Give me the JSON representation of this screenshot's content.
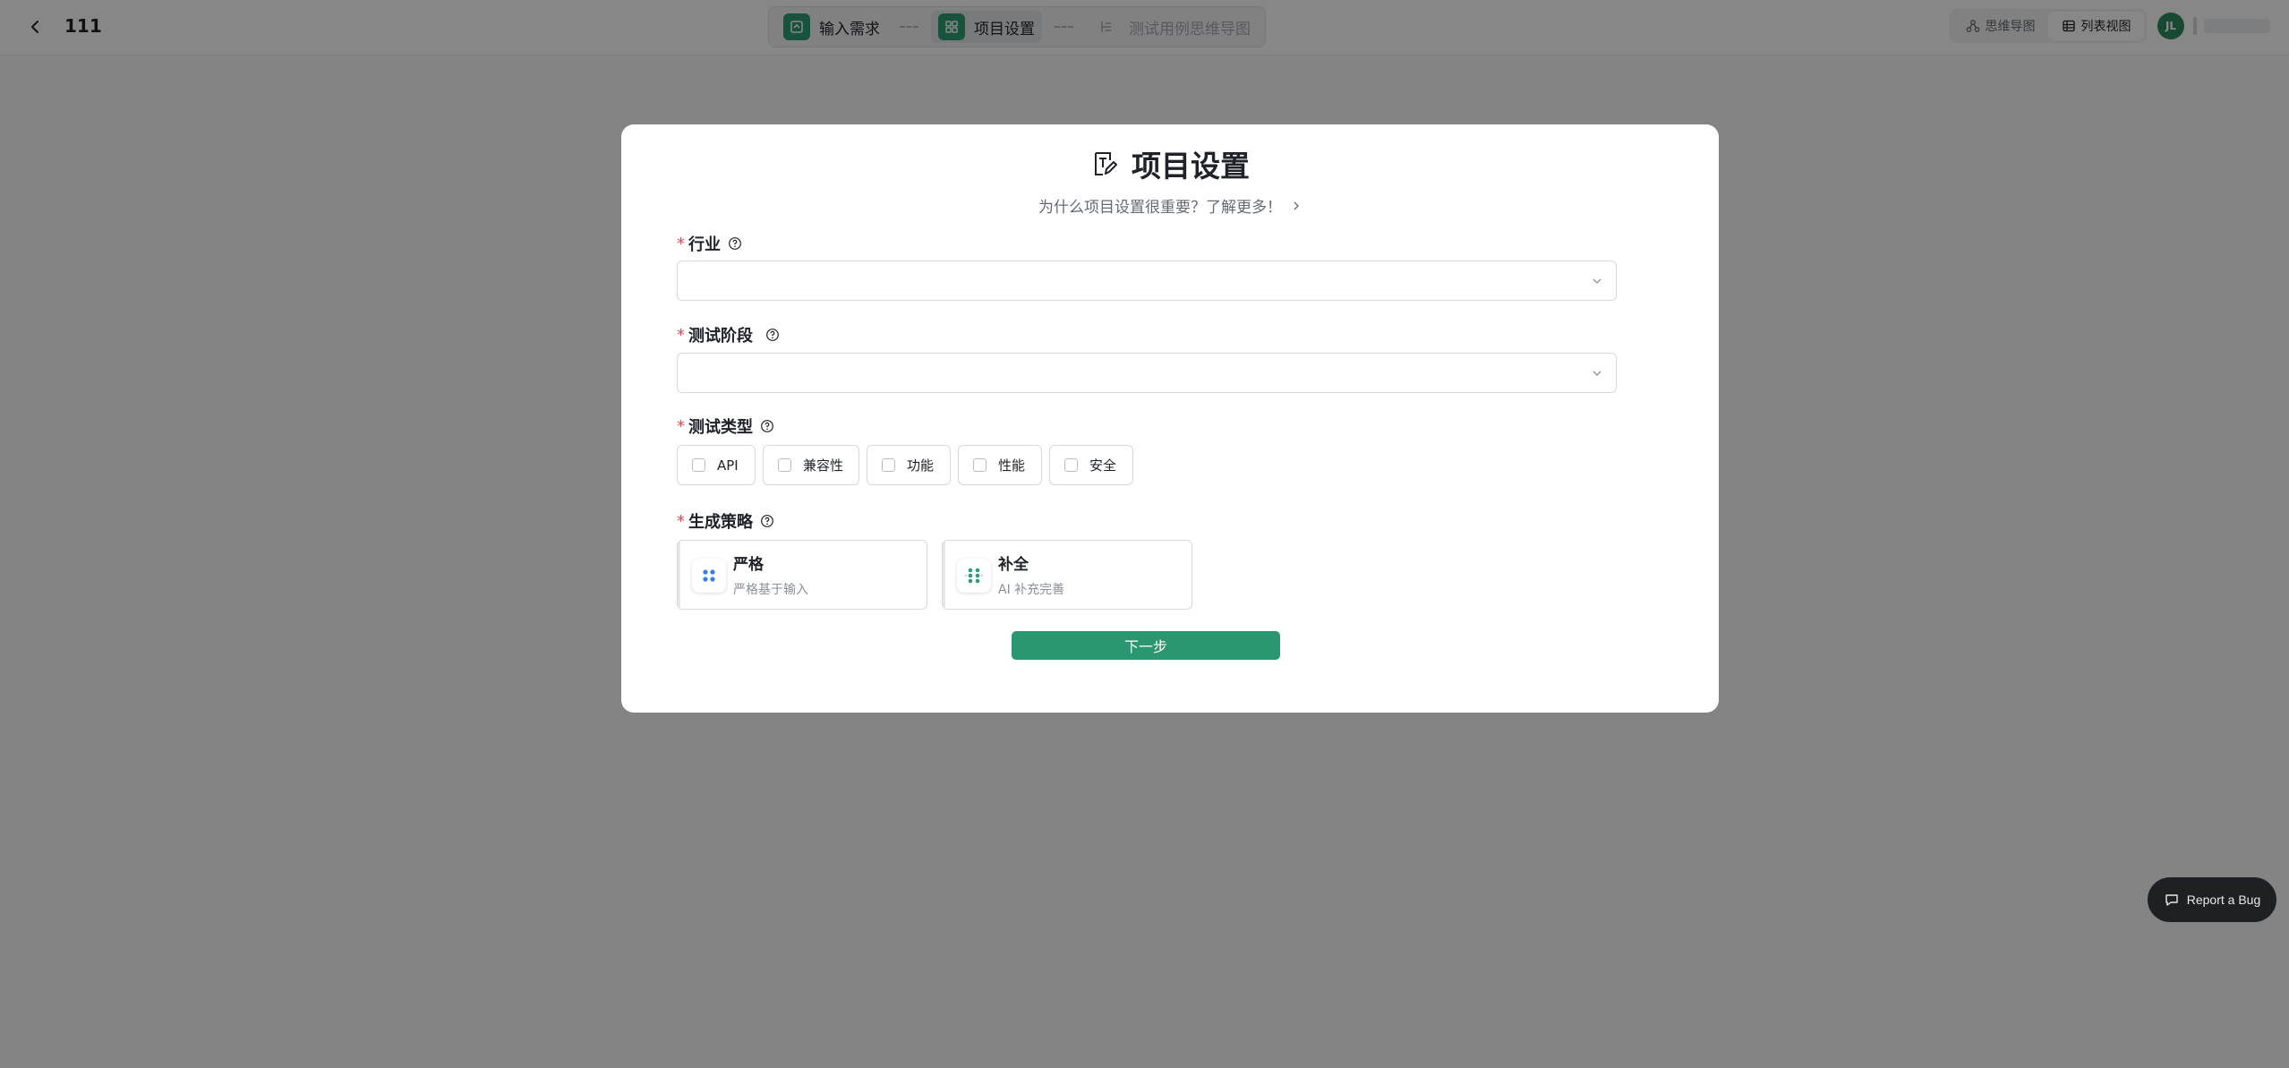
{
  "header": {
    "project_name": "111",
    "steps": [
      {
        "label": "输入需求",
        "state": "done"
      },
      {
        "label": "项目设置",
        "state": "active"
      },
      {
        "label": "测试用例思维导图",
        "state": "disabled"
      }
    ],
    "views": [
      {
        "label": "思维导图",
        "icon": "mindmap-icon",
        "active": false
      },
      {
        "label": "列表视图",
        "icon": "table-icon",
        "active": true
      }
    ],
    "user_initials": "JL"
  },
  "modal": {
    "title": "项目设置",
    "subtitle": "为什么项目设置很重要？了解更多！",
    "fields": {
      "industry": {
        "label": "行业",
        "required_mark": "*",
        "value": ""
      },
      "test_phase": {
        "label": "测试阶段",
        "required_mark": "*",
        "value": ""
      },
      "test_type": {
        "label": "测试类型",
        "required_mark": "*",
        "options": [
          {
            "label": "API",
            "checked": false
          },
          {
            "label": "兼容性",
            "checked": false
          },
          {
            "label": "功能",
            "checked": false
          },
          {
            "label": "性能",
            "checked": false
          },
          {
            "label": "安全",
            "checked": false
          }
        ]
      },
      "strategy": {
        "label": "生成策略",
        "required_mark": "*",
        "options": [
          {
            "title": "严格",
            "desc": "严格基于输入",
            "icon": "grid-dots-icon",
            "color": "#3b7ddd"
          },
          {
            "title": "补全",
            "desc": "AI 补充完善",
            "icon": "expand-dots-icon",
            "color": "#2f9e76"
          }
        ]
      }
    },
    "next_label": "下一步"
  },
  "report_bug": {
    "label": "Report a Bug"
  },
  "colors": {
    "accent": "#2b9770",
    "required": "#e34d59",
    "overlay": "rgba(0,0,0,0.47)"
  }
}
